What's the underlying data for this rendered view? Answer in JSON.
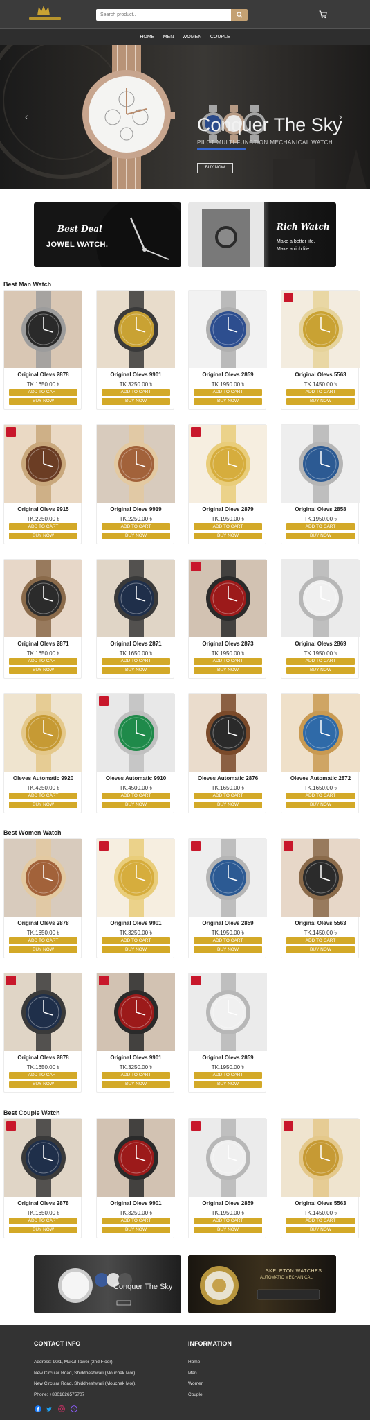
{
  "header": {
    "search_placeholder": "Search product.."
  },
  "nav": [
    "HOME",
    "MEN",
    "WOMEN",
    "COUPLE"
  ],
  "hero": {
    "title": "Conquer The Sky",
    "subtitle": "PILOT MULTI-FUNCTION MECHANICAL WATCH",
    "button": "BUY NOW",
    "prev": "‹",
    "next": "›"
  },
  "promos": {
    "left": {
      "script": "Best Deal",
      "bold": "JOWEL WATCH."
    },
    "right": {
      "script": "Rich Watch",
      "line1": "Make a better life.",
      "line2": "Make a rich life"
    }
  },
  "currency_symbol": "৳",
  "buttons": {
    "cart": "ADD TO CART",
    "buy": "BUY NOW"
  },
  "sections": {
    "man": {
      "title": "Best Man Watch",
      "products": [
        {
          "name": "Original Olevs 2878",
          "price": "TK.1650.00"
        },
        {
          "name": "Original Olevs 9901",
          "price": "TK.3250.00"
        },
        {
          "name": "Original Olevs 2859",
          "price": "TK.1950.00"
        },
        {
          "name": "Original Olevs 5563",
          "price": "TK.1450.00"
        },
        {
          "name": "Original Olevs 9915",
          "price": "TK.2250.00"
        },
        {
          "name": "Original Olevs 9919",
          "price": "TK.2250.00"
        },
        {
          "name": "Original Olevs 2879",
          "price": "TK.1950.00"
        },
        {
          "name": "Original Olevs 2858",
          "price": "TK.1950.00"
        },
        {
          "name": "Original Olevs 2871",
          "price": "TK.1650.00"
        },
        {
          "name": "Original Olevs 2871",
          "price": "TK.1650.00"
        },
        {
          "name": "Original Olevs 2873",
          "price": "TK.1950.00"
        },
        {
          "name": "Original Olevs 2869",
          "price": "TK.1950.00"
        },
        {
          "name": "Oleves Automatic 9920",
          "price": "TK.4250.00"
        },
        {
          "name": "Oleves Automatic 9910",
          "price": "TK.4500.00"
        },
        {
          "name": "Oleves Automatic 2876",
          "price": "TK.1650.00"
        },
        {
          "name": "Oleves Automatic 2872",
          "price": "TK.1650.00"
        }
      ]
    },
    "women": {
      "title": "Best Women Watch",
      "products": [
        {
          "name": "Original Olevs 2878",
          "price": "TK.1650.00"
        },
        {
          "name": "Original Olevs 9901",
          "price": "TK.3250.00"
        },
        {
          "name": "Original Olevs 2859",
          "price": "TK.1950.00"
        },
        {
          "name": "Original Olevs 5563",
          "price": "TK.1450.00"
        },
        {
          "name": "Original Olevs 2878",
          "price": "TK.1650.00"
        },
        {
          "name": "Original Olevs 9901",
          "price": "TK.3250.00"
        },
        {
          "name": "Original Olevs 2859",
          "price": "TK.1950.00"
        }
      ]
    },
    "couple": {
      "title": "Best Couple Watch",
      "products": [
        {
          "name": "Original Olevs 2878",
          "price": "TK.1650.00"
        },
        {
          "name": "Original Olevs 9901",
          "price": "TK.3250.00"
        },
        {
          "name": "Original Olevs 2859",
          "price": "TK.1950.00"
        },
        {
          "name": "Original Olevs 5563",
          "price": "TK.1450.00"
        }
      ]
    }
  },
  "bottom_banners": {
    "left": {
      "title": "Conquer The Sky"
    },
    "right": {
      "title": "SKELETON WATCHES",
      "subtitle": "AUTOMATIC MECHANICAL"
    }
  },
  "footer": {
    "contact": {
      "heading": "CONTACT INFO",
      "address1": "Address: 90/1, Mukul Tower (2nd Floor),",
      "address2": "New Circular Road, Shiddheshwari (Mouchak Mor).",
      "address3": "New Circular Road, Shiddheshwari (Mouchak Mor).",
      "phone": "Phone: +8801626575707"
    },
    "info": {
      "heading": "INFORMATION",
      "links": [
        "Home",
        "Man",
        "Women",
        "Couple"
      ]
    }
  },
  "colors": {
    "header_bg": "#3b3b3b",
    "button_gold": "#d3a928",
    "footer_bg": "#333333",
    "search_button": "#c4a173"
  }
}
